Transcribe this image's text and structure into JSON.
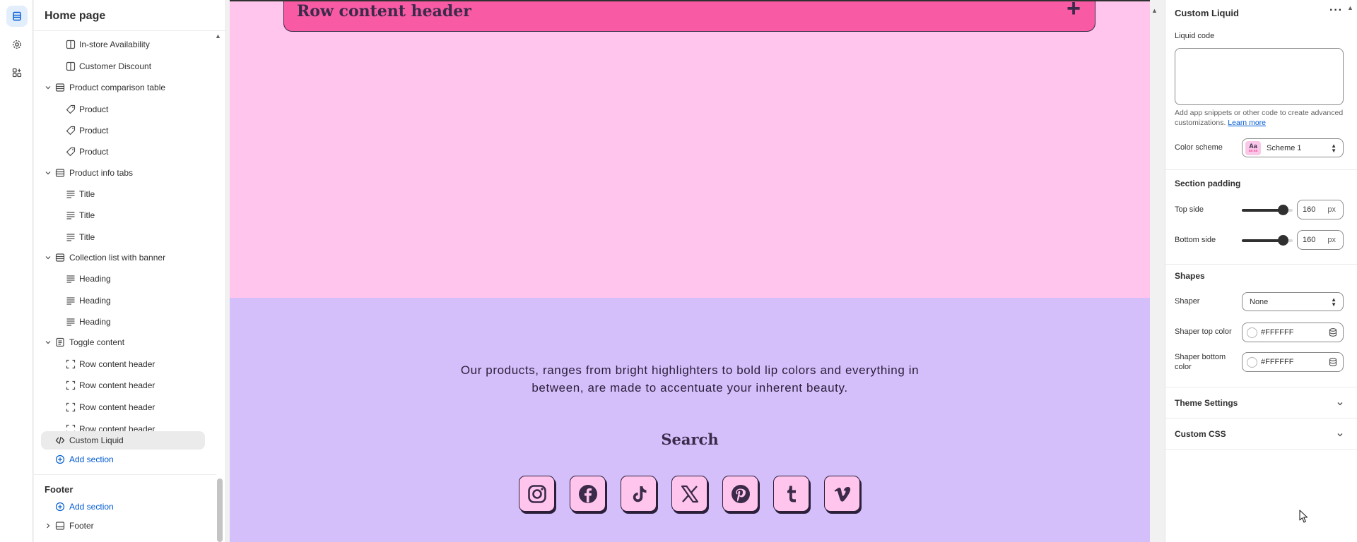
{
  "sidebar": {
    "title": "Home page",
    "items": [
      {
        "label": "In-store Availability"
      },
      {
        "label": "Customer Discount"
      },
      {
        "label": "Product comparison table"
      },
      {
        "label": "Product"
      },
      {
        "label": "Product"
      },
      {
        "label": "Product"
      },
      {
        "label": "Product info tabs"
      },
      {
        "label": "Title"
      },
      {
        "label": "Title"
      },
      {
        "label": "Title"
      },
      {
        "label": "Collection list with banner"
      },
      {
        "label": "Heading"
      },
      {
        "label": "Heading"
      },
      {
        "label": "Heading"
      },
      {
        "label": "Toggle content"
      },
      {
        "label": "Row content header"
      },
      {
        "label": "Row content header"
      },
      {
        "label": "Row content header"
      },
      {
        "label": "Row content header"
      },
      {
        "label": "Custom Liquid"
      },
      {
        "label": "Add section"
      }
    ],
    "footer": {
      "title": "Footer",
      "add_label": "Add section",
      "group_label": "Footer"
    }
  },
  "preview": {
    "accordion_header": "Row content header",
    "about_text": "Our products, ranges from bright highlighters to bold lip colors and everything in between, are made to accentuate your inherent beauty.",
    "search_heading": "Search",
    "social_icons": [
      "instagram-icon",
      "facebook-icon",
      "tiktok-icon",
      "x-icon",
      "pinterest-icon",
      "tumblr-icon",
      "vimeo-icon"
    ],
    "colors": {
      "pink_bg": "#ffc5ec",
      "accent_pink": "#f85aa4",
      "lavender_bg": "#d5bffb",
      "ink": "#3b2a4a"
    }
  },
  "panel": {
    "title": "Custom Liquid",
    "liquid_label": "Liquid code",
    "liquid_value": "",
    "help_text": "Add app snippets or other code to create advanced customizations.",
    "learn_more": "Learn more",
    "color_scheme_label": "Color scheme",
    "color_scheme_chip": "Aa",
    "color_scheme_chip_small": "aa aa",
    "color_scheme_value": "Scheme 1",
    "section_padding": "Section padding",
    "top_label": "Top side",
    "top_value": "160",
    "top_fraction": 0.8,
    "bottom_label": "Bottom side",
    "bottom_value": "160",
    "bottom_fraction": 0.8,
    "unit": "px",
    "shapes": "Shapes",
    "shaper_label": "Shaper",
    "shaper_value": "None",
    "shaper_top_label": "Shaper top color",
    "shaper_top_value": "#FFFFFF",
    "shaper_bottom_label": "Shaper bottom color",
    "shaper_bottom_value": "#FFFFFF",
    "theme_settings": "Theme Settings",
    "custom_css": "Custom CSS",
    "accent": "#005bd3"
  }
}
